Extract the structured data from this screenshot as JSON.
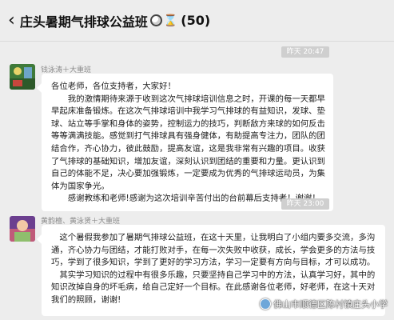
{
  "header": {
    "back_icon": "chevron-left-icon",
    "title": "庄头暑期气排球公益班",
    "member_count": "(50)"
  },
  "messages": [
    {
      "time": "昨天 20:47",
      "sender": "钱泳涛＋大重班",
      "paragraphs": [
        "各位老师，各位支持者，大家好！",
        "我的激情期待来源于收到这次气排球培训信息之时，开课的每一天都早早起床准备锻炼。在这次气排球培训中我学习气排球的有益知识，发球、垫球、站立等手掌和身体的姿势，控制运力的技巧，判断敌方来球的如何反击等等满满技能。感觉到打气排球具有强身健体，有助提高专注力，团队的团结合作，齐心协力，彼此鼓励，提高友谊，这是我非常有兴趣的项目。收获了气排球的基础知识，增加友谊，深刻认识到团结的重要和力量。更认识到自己的体能不足，决心要加强锻炼，一定要成为优秀的气排球运动员，为集体为国家争光。",
        "感谢教练和老师!感谢为这次培训辛苦付出的台前幕后支持者！谢谢！"
      ]
    },
    {
      "time": "昨天 23:00",
      "sender": "黄韵檀、黄泳贤＋大重班",
      "paragraphs": [
        "这个暑假我参加了暑期气排球公益班，在这十天里，让我明白了小组内要多交流，多沟通，齐心协力与团结，才能打败对手，在每一次失败中收获，成长，学会更多的方法与技巧，学到了很多知识，学到了更好的学习方法，学习一定要有方向与目标，才可以成功。",
        "其实学习知识的过程中有很多乐趣，只要坚持自己学习中的方法，认真学习好，其中的知识改掉自身的坏毛病，给自己定好一个目标。在此感谢各位老师，好老师，在这十天对我们的照顾，谢谢!"
      ]
    }
  ],
  "watermark": "佛山市顺德区陈村镇庄头小学"
}
